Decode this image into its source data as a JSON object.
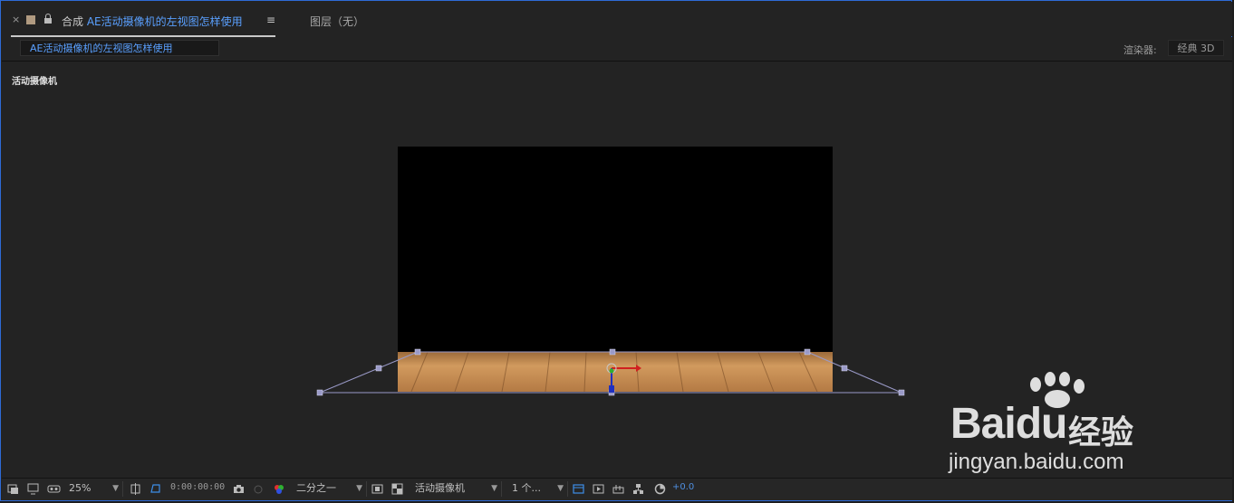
{
  "tab": {
    "close": "×",
    "comp_prefix": "合成",
    "comp_name": "AE活动摄像机的左视图怎样使用",
    "menu": "≡",
    "layer_label": "图层（无）"
  },
  "breadcrumb": "AE活动摄像机的左视图怎样使用",
  "renderer": {
    "label": "渲染器:",
    "value": "经典 3D"
  },
  "viewer": {
    "label": "活动摄像机"
  },
  "toolbar": {
    "zoom": "25%",
    "timecode": "0:00:00:00",
    "resolution": "二分之一",
    "camera_view": "活动摄像机",
    "views": "1 个...",
    "exposure": "+0.0"
  },
  "watermark": {
    "brand_left": "Bai",
    "brand_right": "du",
    "cn": "经验",
    "url": "jingyan.baidu.com"
  },
  "colors": {
    "accent": "#5aa0ff",
    "frame_border": "#2e6bd6",
    "wood": "#c8925a",
    "handle": "#9a9ac8"
  },
  "icons": [
    "close-icon",
    "color-swatch-icon",
    "lock-icon",
    "panel-menu-icon",
    "always-preview-icon",
    "monitor-icon",
    "vr-icon",
    "region-of-interest-icon",
    "transparency-grid-icon",
    "camera-snapshot-icon",
    "show-snapshot-icon",
    "channel-icon",
    "fast-preview-icon",
    "toggle-mask-icon",
    "3d-draft-icon",
    "timeline-icon",
    "flowchart-icon",
    "reset-exposure-icon"
  ]
}
